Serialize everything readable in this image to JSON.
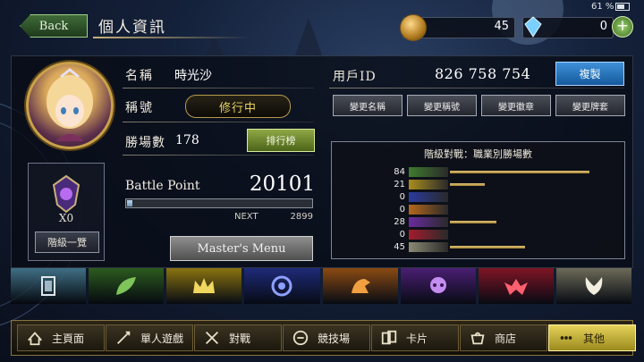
{
  "status": {
    "battery": "61 %"
  },
  "header": {
    "back_label": "Back",
    "title": "個人資訊"
  },
  "currency": {
    "gold": "45",
    "crystal": "0",
    "add": "+"
  },
  "profile": {
    "name_label": "名稱",
    "name_value": "時光沙",
    "title_label": "稱號",
    "title_value": "修行中",
    "wins_label": "勝場數",
    "wins_value": "178",
    "ranking_button": "排行榜",
    "bp_label": "Battle Point",
    "bp_value": "20101",
    "bp_progress": 0.03,
    "next_label": "NEXT",
    "next_value": "2899",
    "master_menu": "Master's Menu",
    "rank_count": "X0",
    "rank_list_button": "階級一覽"
  },
  "account": {
    "uid_label": "用戶ID",
    "uid_value": "826 758 754",
    "copy_button": "複製",
    "change_buttons": [
      "變更名稱",
      "變更稱號",
      "變更徽章",
      "變更牌套"
    ]
  },
  "stats": {
    "title": "階級對戰：職業別勝場數",
    "max": 84,
    "rows": [
      {
        "value": "84",
        "num": 84,
        "color": "#3f7a2e",
        "icon": "forestcraft-icon"
      },
      {
        "value": "21",
        "num": 21,
        "color": "#a98d1d",
        "icon": "swordcraft-icon"
      },
      {
        "value": "0",
        "num": 0,
        "color": "#2a3aa0",
        "icon": "runecraft-icon"
      },
      {
        "value": "0",
        "num": 0,
        "color": "#b5681b",
        "icon": "dragoncraft-icon"
      },
      {
        "value": "28",
        "num": 28,
        "color": "#6a2aa0",
        "icon": "shadowcraft-icon"
      },
      {
        "value": "0",
        "num": 0,
        "color": "#a41c2c",
        "icon": "bloodcraft-icon"
      },
      {
        "value": "45",
        "num": 45,
        "color": "#8c8a74",
        "icon": "havencraft-icon"
      }
    ]
  },
  "classes": [
    {
      "name": "neutral-tab",
      "icon": "card-icon",
      "bg": "#3f6f84"
    },
    {
      "name": "forestcraft-tab",
      "icon": "leaf-icon",
      "bg": "#2c5a1e"
    },
    {
      "name": "swordcraft-tab",
      "icon": "crown-icon",
      "bg": "#8a7310"
    },
    {
      "name": "runecraft-tab",
      "icon": "rune-icon",
      "bg": "#1e2a78"
    },
    {
      "name": "dragoncraft-tab",
      "icon": "dragon-icon",
      "bg": "#8a4a12"
    },
    {
      "name": "shadowcraft-tab",
      "icon": "skull-icon",
      "bg": "#4a1e72"
    },
    {
      "name": "bloodcraft-tab",
      "icon": "bat-icon",
      "bg": "#7e1424"
    },
    {
      "name": "havencraft-tab",
      "icon": "wings-icon",
      "bg": "#6c6a58"
    }
  ],
  "nav": [
    {
      "label": "主頁面",
      "icon": "home-icon"
    },
    {
      "label": "單人遊戲",
      "icon": "solo-play-icon"
    },
    {
      "label": "對戰",
      "icon": "battle-icon"
    },
    {
      "label": "競技場",
      "icon": "arena-icon"
    },
    {
      "label": "卡片",
      "icon": "cards-icon"
    },
    {
      "label": "商店",
      "icon": "shop-icon"
    },
    {
      "label": "其他",
      "icon": "other-icon",
      "active": true
    }
  ]
}
